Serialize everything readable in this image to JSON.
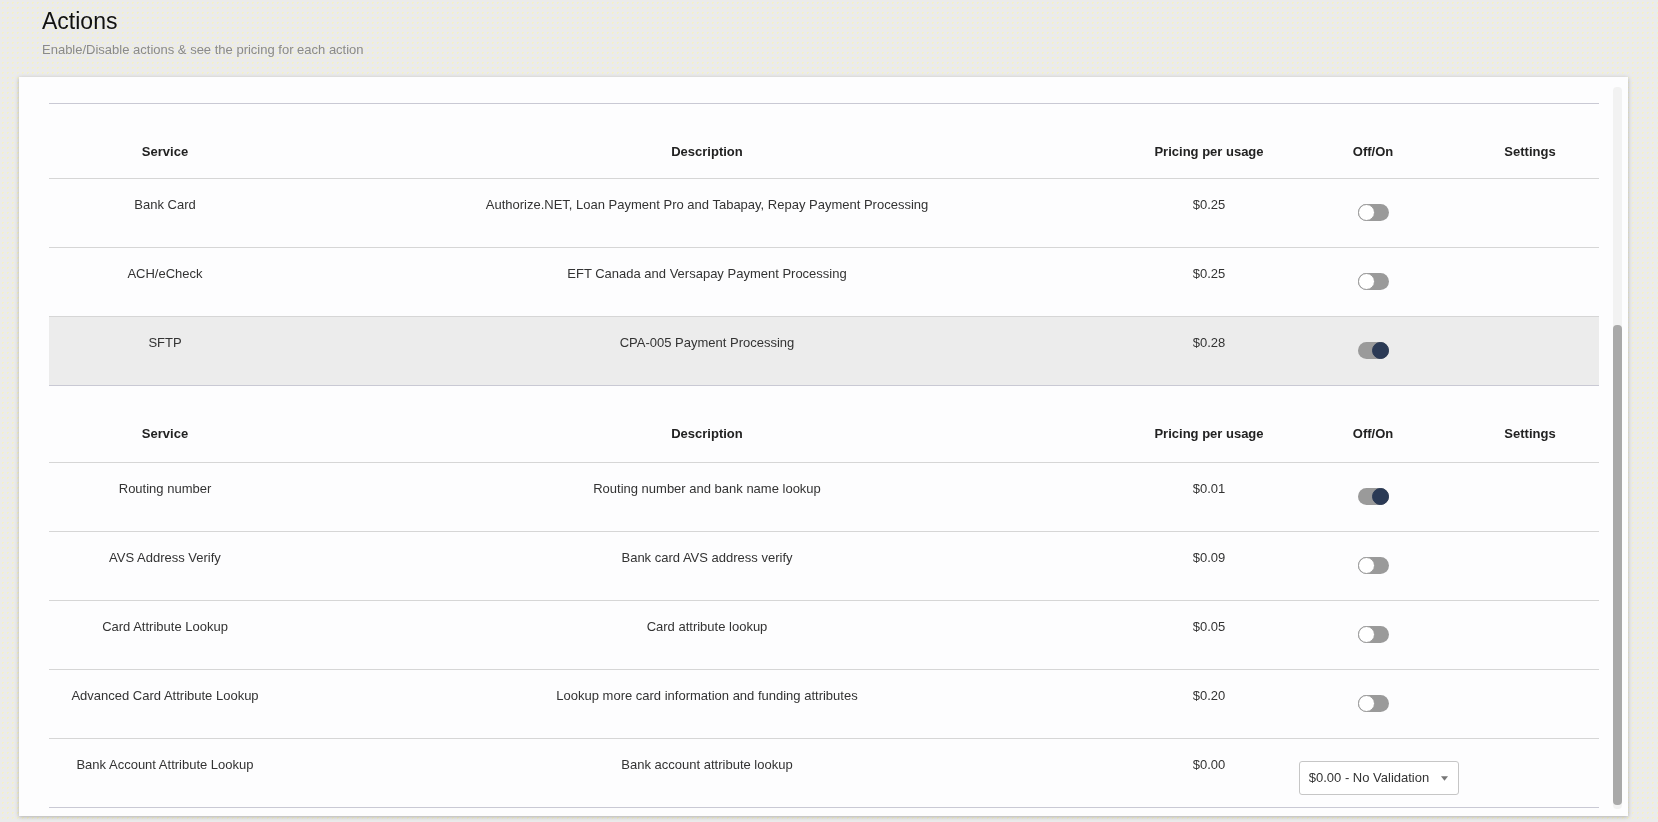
{
  "page": {
    "title": "Actions",
    "subtitle": "Enable/Disable actions & see the pricing for each action"
  },
  "tables": [
    {
      "columns": [
        "Service",
        "Description",
        "Pricing per usage",
        "Off/On",
        "Settings"
      ],
      "rows": [
        {
          "service": "Bank Card",
          "description": "Authorize.NET, Loan Payment Pro and Tabapay, Repay Payment Processing",
          "price": "$0.25",
          "kind": "toggle",
          "on": false,
          "highlighted": false
        },
        {
          "service": "ACH/eCheck",
          "description": "EFT Canada and Versapay Payment Processing",
          "price": "$0.25",
          "kind": "toggle",
          "on": false,
          "highlighted": false
        },
        {
          "service": "SFTP",
          "description": "CPA-005 Payment Processing",
          "price": "$0.28",
          "kind": "toggle",
          "on": true,
          "highlighted": true
        }
      ]
    },
    {
      "columns": [
        "Service",
        "Description",
        "Pricing per usage",
        "Off/On",
        "Settings"
      ],
      "rows": [
        {
          "service": "Routing number",
          "description": "Routing number and bank name lookup",
          "price": "$0.01",
          "kind": "toggle",
          "on": true,
          "highlighted": false
        },
        {
          "service": "AVS Address Verify",
          "description": "Bank card AVS address verify",
          "price": "$0.09",
          "kind": "toggle",
          "on": false,
          "highlighted": false
        },
        {
          "service": "Card Attribute Lookup",
          "description": "Card attribute lookup",
          "price": "$0.05",
          "kind": "toggle",
          "on": false,
          "highlighted": false
        },
        {
          "service": "Advanced Card Attribute Lookup",
          "description": "Lookup more card information and funding attributes",
          "price": "$0.20",
          "kind": "toggle",
          "on": false,
          "highlighted": false
        },
        {
          "service": "Bank Account Attribute Lookup",
          "description": "Bank account attribute lookup",
          "price": "$0.00",
          "kind": "select",
          "value": "$0.00 - No Validation",
          "highlighted": false
        }
      ]
    }
  ]
}
